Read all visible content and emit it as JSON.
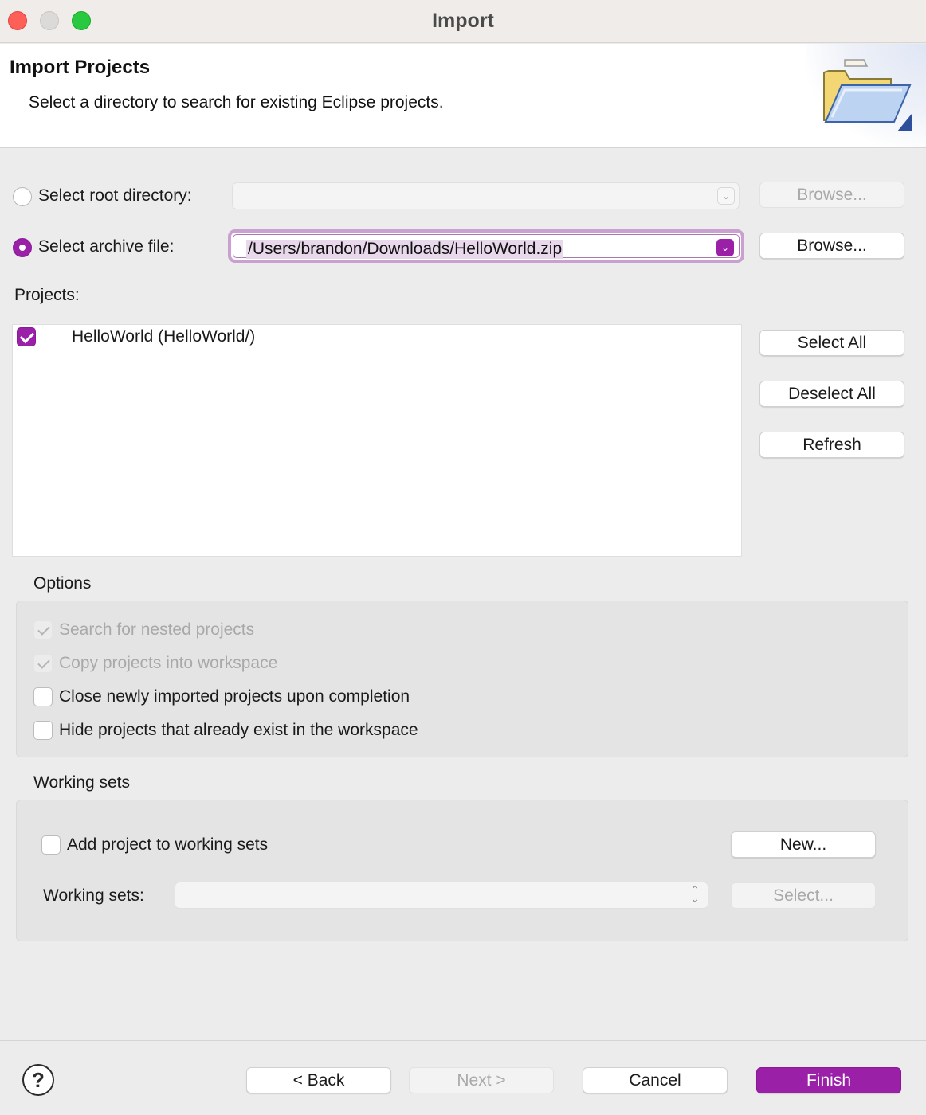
{
  "window": {
    "title": "Import"
  },
  "header": {
    "title": "Import Projects",
    "description": "Select a directory to search for existing Eclipse projects."
  },
  "source": {
    "root_directory_label": "Select root directory:",
    "root_directory_value": "",
    "root_browse_label": "Browse...",
    "archive_file_label": "Select archive file:",
    "archive_file_value": "/Users/brandon/Downloads/HelloWorld.zip",
    "archive_browse_label": "Browse...",
    "selected_option": "archive"
  },
  "projects": {
    "label": "Projects:",
    "items": [
      {
        "name": "HelloWorld (HelloWorld/)",
        "checked": true
      }
    ],
    "select_all_label": "Select All",
    "deselect_all_label": "Deselect All",
    "refresh_label": "Refresh"
  },
  "options": {
    "label": "Options",
    "items": [
      {
        "label": "Search for nested projects",
        "checked": true,
        "enabled": false
      },
      {
        "label": "Copy projects into workspace",
        "checked": true,
        "enabled": false
      },
      {
        "label": "Close newly imported projects upon completion",
        "checked": false,
        "enabled": true
      },
      {
        "label": "Hide projects that already exist in the workspace",
        "checked": false,
        "enabled": true
      }
    ]
  },
  "working_sets": {
    "label": "Working sets",
    "add_label": "Add project to working sets",
    "add_checked": false,
    "new_button_label": "New...",
    "sets_label": "Working sets:",
    "sets_value": "",
    "select_button_label": "Select..."
  },
  "footer": {
    "help_glyph": "?",
    "back_label": "< Back",
    "next_label": "Next >",
    "cancel_label": "Cancel",
    "finish_label": "Finish"
  },
  "colors": {
    "accent": "#9a20a8",
    "window_bg": "#ececec",
    "close": "#fe5f57",
    "zoom": "#28c840"
  }
}
